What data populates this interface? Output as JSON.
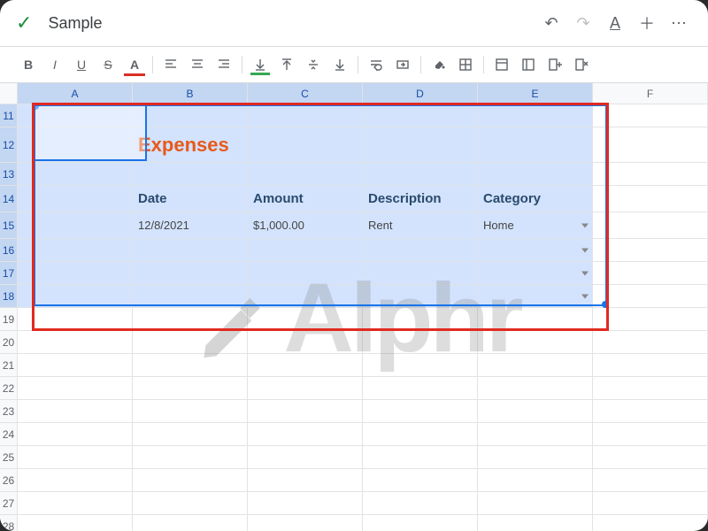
{
  "doc": {
    "title": "Sample"
  },
  "columns": [
    "A",
    "B",
    "C",
    "D",
    "E",
    "F"
  ],
  "selectedCols": [
    "A",
    "B",
    "C",
    "D",
    "E"
  ],
  "rows": [
    11,
    12,
    13,
    14,
    15,
    16,
    17,
    18,
    19,
    20,
    21,
    22,
    23,
    24,
    25,
    26,
    27,
    28
  ],
  "selectedRows": [
    11,
    12,
    13,
    14,
    15,
    16,
    17,
    18
  ],
  "content": {
    "title": "Expenses",
    "headers": {
      "date": "Date",
      "amount": "Amount",
      "desc": "Description",
      "cat": "Category"
    },
    "data": {
      "date": "12/8/2021",
      "amount": "$1,000.00",
      "desc": "Rent",
      "cat": "Home"
    }
  },
  "watermark": "Alphr"
}
